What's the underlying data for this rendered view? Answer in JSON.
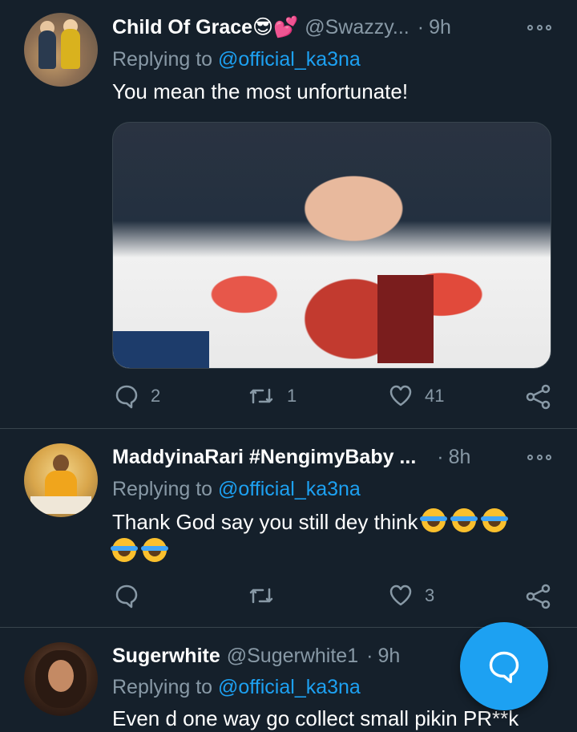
{
  "tweets": [
    {
      "name": "Child Of Grace😎💕",
      "handle": "@Swazzy...",
      "dot": "·",
      "time": "9h",
      "replying_prefix": "Replying to ",
      "replying_to": "@official_ka3na",
      "text": "You mean the most unfortunate!",
      "has_media": true,
      "replies": "2",
      "retweets": "1",
      "likes": "41"
    },
    {
      "name": "MaddyinaRari #NengimyBaby ...",
      "handle": "",
      "dot": "·",
      "time": "8h",
      "replying_prefix": "Replying to ",
      "replying_to": "@official_ka3na",
      "text": "Thank God say you still dey think",
      "emoji_count": 5,
      "replies": "",
      "retweets": "",
      "likes": "3"
    },
    {
      "name": "Sugerwhite",
      "handle": "@Sugerwhite1",
      "dot": "·",
      "time": "9h",
      "replying_prefix": "Replying to ",
      "replying_to": "@official_ka3na",
      "text": "Even d one way go collect small pikin PR**k"
    }
  ],
  "icons": {
    "reply": "reply-icon",
    "retweet": "retweet-icon",
    "like": "heart-icon",
    "share": "share-icon",
    "more": "more-options-icon",
    "compose": "compose-reply-icon"
  },
  "colors": {
    "background": "#15202b",
    "secondary_text": "#8899a6",
    "accent": "#1da1f2",
    "divider": "#38444d"
  }
}
